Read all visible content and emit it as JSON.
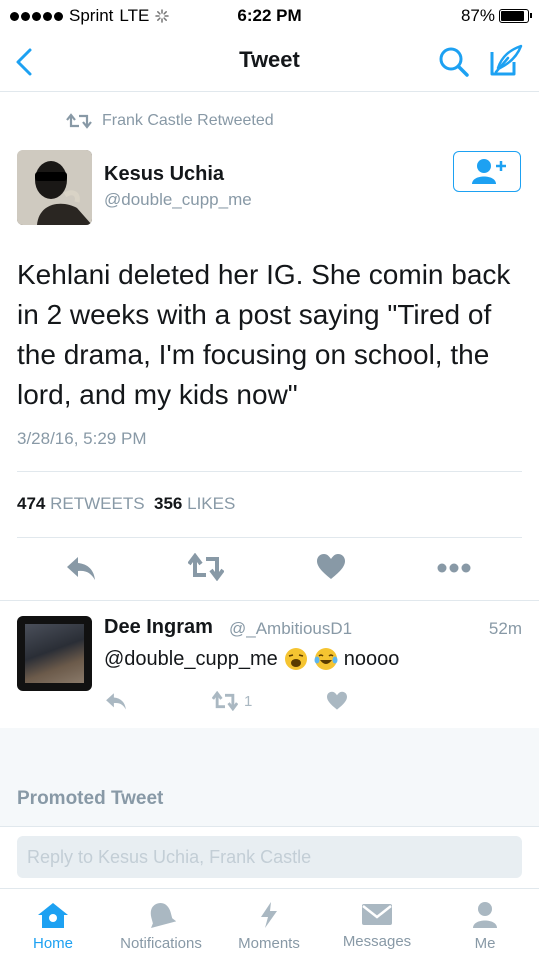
{
  "status_bar": {
    "carrier": "Sprint",
    "network": "LTE",
    "time": "6:22 PM",
    "battery": "87%",
    "battery_level": 0.87
  },
  "nav": {
    "title": "Tweet",
    "back_icon": "chevron-left-icon",
    "search_icon": "search-icon",
    "compose_icon": "compose-icon",
    "accent_color": "#1da1f2"
  },
  "tweet": {
    "retweeted_by": "Frank Castle Retweeted",
    "author_name": "Kesus Uchia",
    "author_handle": "@double_cupp_me",
    "text": "Kehlani deleted her IG. She comin back in 2 weeks with a post saying \"Tired of the drama, I'm focusing on school, the lord, and my kids now\"",
    "timestamp": "3/28/16, 5:29 PM",
    "retweets_count": "474",
    "retweets_label": "RETWEETS",
    "likes_count": "356",
    "likes_label": "LIKES"
  },
  "reply": {
    "name": "Dee Ingram",
    "handle": "@_AmbitiousD1",
    "time": "52m",
    "mention": "@double_cupp_me",
    "emojis": [
      "weary-face-emoji",
      "tears-of-joy-emoji"
    ],
    "text": "noooo",
    "retweet_count": "1"
  },
  "promoted": {
    "label": "Promoted Tweet"
  },
  "reply_bar": {
    "placeholder": "Reply to Kesus Uchia, Frank Castle"
  },
  "tabbar": {
    "tabs": [
      {
        "label": "Home",
        "icon": "home-icon",
        "active": true
      },
      {
        "label": "Notifications",
        "icon": "bell-icon",
        "active": false
      },
      {
        "label": "Moments",
        "icon": "lightning-icon",
        "active": false
      },
      {
        "label": "Messages",
        "icon": "envelope-icon",
        "active": false
      },
      {
        "label": "Me",
        "icon": "person-icon",
        "active": false
      }
    ]
  }
}
